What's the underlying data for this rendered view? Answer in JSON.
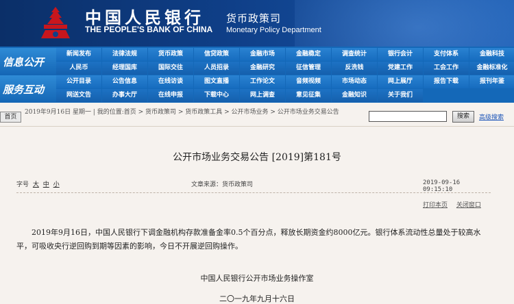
{
  "header": {
    "bank_name_cn": "中国人民银行",
    "bank_name_en": "THE PEOPLE'S BANK OF CHINA",
    "dept_cn": "货币政策司",
    "dept_en": "Monetary Policy Department"
  },
  "nav": {
    "section1": "信息公开",
    "section2": "服务互动",
    "rows": [
      [
        "新闻发布",
        "法律法规",
        "货币政策",
        "信贷政策",
        "金融市场",
        "金融稳定",
        "调查统计",
        "银行会计",
        "支付体系",
        "金融科技"
      ],
      [
        "人民币",
        "经理国库",
        "国际交往",
        "人员招录",
        "金融研究",
        "征信管理",
        "反洗钱",
        "党建工作",
        "工会工作",
        "金融标准化"
      ],
      [
        "公开目录",
        "公告信息",
        "在线访谈",
        "图文直播",
        "工作论文",
        "音频视频",
        "市场动态",
        "网上展厅",
        "报告下载",
        "报刊年鉴"
      ],
      [
        "网送文告",
        "办事大厅",
        "在线申报",
        "下载中心",
        "网上调查",
        "意见征集",
        "金融知识",
        "关于我们"
      ]
    ]
  },
  "crumb": {
    "home_label": "首页",
    "text": "2019年9月16日 星期一 | 我的位置:首页 > 货币政策司 > 货币政策工具 > 公开市场业务 > 公开市场业务交易公告",
    "search_placeholder": "",
    "search_button": "搜索",
    "advanced_search": "高级搜索"
  },
  "article": {
    "title": "公开市场业务交易公告 [2019]第181号",
    "font_size_label": "字号",
    "font_sizes": [
      "大",
      "中",
      "小"
    ],
    "source": "文章来源：货币政策司",
    "datetime": "2019-09-16 09:15:10",
    "print_label": "打印本页",
    "close_label": "关闭窗口",
    "body": "2019年9月16日，中国人民银行下调金融机构存款准备金率0.5个百分点，释放长期资金约8000亿元。银行体系流动性总量处于较高水平，可吸收央行逆回购到期等因素的影响，今日不开展逆回购操作。",
    "signature": "中国人民银行公开市场业务操作室",
    "date_cn": "二〇一九年九月十六日"
  },
  "colors": {
    "header_bg": "#0f3f88",
    "nav_bg": "#1468b8",
    "logo_red": "#c8161d",
    "link_blue": "#1d55b8"
  }
}
